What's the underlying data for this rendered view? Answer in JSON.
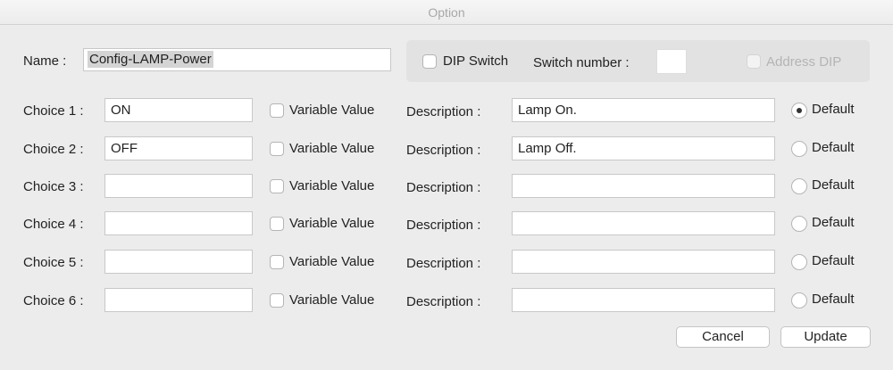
{
  "window": {
    "title": "Option"
  },
  "name": {
    "label": "Name :",
    "value": "Config-LAMP-Power"
  },
  "dip": {
    "dip_switch_label": "DIP Switch",
    "switch_number_label": "Switch number :",
    "switch_number_value": "",
    "address_dip_label": "Address DIP"
  },
  "choices": [
    {
      "label": "Choice 1 :",
      "value": "ON",
      "variable_label": "Variable Value",
      "description_label": "Description :",
      "description": "Lamp On.",
      "default_label": "Default",
      "default": true
    },
    {
      "label": "Choice 2 :",
      "value": "OFF",
      "variable_label": "Variable Value",
      "description_label": "Description :",
      "description": "Lamp Off.",
      "default_label": "Default",
      "default": false
    },
    {
      "label": "Choice 3 :",
      "value": "",
      "variable_label": "Variable Value",
      "description_label": "Description :",
      "description": "",
      "default_label": "Default",
      "default": false
    },
    {
      "label": "Choice 4 :",
      "value": "",
      "variable_label": "Variable Value",
      "description_label": "Description :",
      "description": "",
      "default_label": "Default",
      "default": false
    },
    {
      "label": "Choice 5 :",
      "value": "",
      "variable_label": "Variable Value",
      "description_label": "Description :",
      "description": "",
      "default_label": "Default",
      "default": false
    },
    {
      "label": "Choice 6 :",
      "value": "",
      "variable_label": "Variable Value",
      "description_label": "Description :",
      "description": "",
      "default_label": "Default",
      "default": false
    }
  ],
  "buttons": {
    "cancel": "Cancel",
    "update": "Update"
  }
}
